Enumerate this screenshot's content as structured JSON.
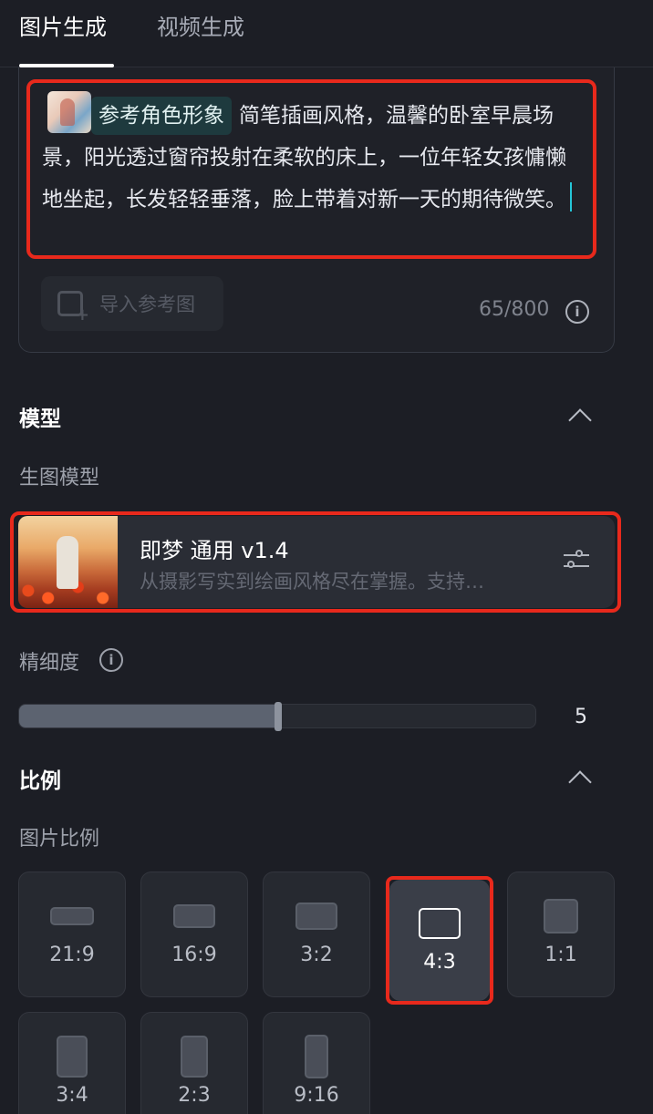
{
  "tabs": {
    "image": "图片生成",
    "video": "视频生成"
  },
  "prompt": {
    "reference_chip": "参考角色形象",
    "text": "简笔插画风格，温馨的卧室早晨场景，阳光透过窗帘投射在柔软的床上，一位年轻女孩慵懒地坐起，长发轻轻垂落，脸上带着对新一天的期待微笑。",
    "import_button": "导入参考图",
    "counter": "65/800",
    "info_icon": "i"
  },
  "model_section": {
    "title": "模型",
    "sub_label": "生图模型",
    "model_name": "即梦 通用 v1.4",
    "model_desc": "从摄影写实到绘画风格尽在掌握。支持…"
  },
  "detail": {
    "label": "精细度",
    "info_icon": "i",
    "value": "5",
    "fill_fraction": 0.5
  },
  "ratio_section": {
    "title": "比例",
    "sub_label": "图片比例",
    "options": [
      "21:9",
      "16:9",
      "3:2",
      "4:3",
      "1:1",
      "3:4",
      "2:3",
      "9:16"
    ],
    "selected": "4:3"
  },
  "colors": {
    "highlight": "#e8291c",
    "accent_caret": "#25c6d8",
    "background": "#1c1e25"
  }
}
